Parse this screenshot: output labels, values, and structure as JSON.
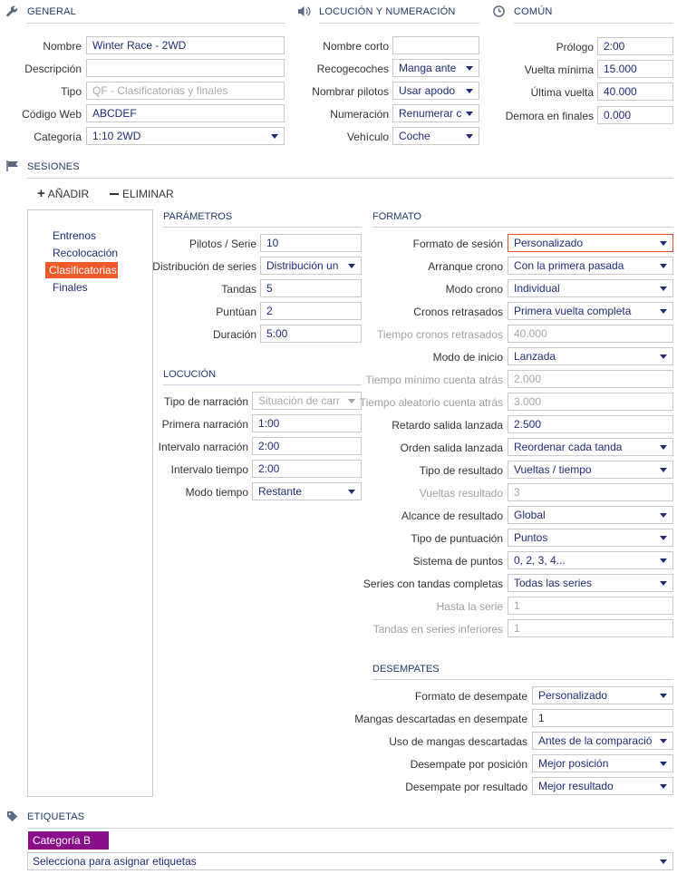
{
  "general": {
    "title": "GENERAL",
    "fields": [
      {
        "label": "Nombre",
        "value": "Winter Race - 2WD",
        "placeholder": ""
      },
      {
        "label": "Descripción",
        "value": "",
        "placeholder": ""
      },
      {
        "label": "Tipo",
        "value": "QF - Clasificatorias y finales",
        "placeholder": ""
      },
      {
        "label": "Código Web",
        "value": "ABCDEF",
        "placeholder": ""
      },
      {
        "label": "Categoría",
        "value": "1:10 2WD",
        "placeholder": ""
      }
    ]
  },
  "locucion_numeracion": {
    "title": "LOCUCIÓN Y NUMERACIÓN",
    "fields": [
      {
        "label": "Nombre corto",
        "value": ""
      },
      {
        "label": "Recogecoches",
        "value": "Manga ante"
      },
      {
        "label": "Nombrar pilotos",
        "value": "Usar apodo"
      },
      {
        "label": "Numeración",
        "value": "Renumerar c"
      },
      {
        "label": "Vehículo",
        "value": "Coche"
      }
    ]
  },
  "comun": {
    "title": "COMÚN",
    "fields": [
      {
        "label": "Prólogo",
        "value": "2:00"
      },
      {
        "label": "Vuelta mínima",
        "value": "15.000"
      },
      {
        "label": "Última vuelta",
        "value": "40.000"
      },
      {
        "label": "Demora en finales",
        "value": "0.000"
      }
    ]
  },
  "sesiones": {
    "title": "SESIONES",
    "add_label": "AÑADIR",
    "remove_label": "ELIMINAR",
    "items": [
      "Entrenos",
      "Recolocación",
      "Clasificatorias",
      "Finales"
    ],
    "active_index": 2
  },
  "parametros": {
    "title": "PARÁMETROS",
    "fields": [
      {
        "label": "Pilotos / Serie",
        "value": "10"
      },
      {
        "label": "Distribución de series",
        "value": "Distribución un"
      },
      {
        "label": "Tandas",
        "value": "5"
      },
      {
        "label": "Puntúan",
        "value": "2"
      },
      {
        "label": "Duración",
        "value": "5:00"
      }
    ]
  },
  "locucion": {
    "title": "LOCUCIÓN",
    "fields": [
      {
        "label": "Tipo de narración",
        "value": "Situación de carr"
      },
      {
        "label": "Primera narración",
        "value": "1:00"
      },
      {
        "label": "Intervalo narración",
        "value": "2:00"
      },
      {
        "label": "Intervalo tiempo",
        "value": "2:00"
      },
      {
        "label": "Modo tiempo",
        "value": "Restante"
      }
    ]
  },
  "formato": {
    "title": "FORMATO",
    "fields": [
      {
        "label": "Formato de sesión",
        "value": "Personalizado"
      },
      {
        "label": "Arranque crono",
        "value": "Con la primera pasada"
      },
      {
        "label": "Modo crono",
        "value": "Individual"
      },
      {
        "label": "Cronos retrasados",
        "value": "Primera vuelta completa"
      },
      {
        "label": "Tiempo cronos retrasados",
        "value": "40.000"
      },
      {
        "label": "Modo de inicio",
        "value": "Lanzada"
      },
      {
        "label": "Tiempo mínimo cuenta atrás",
        "value": "2.000"
      },
      {
        "label": "Tiempo aleatorio cuenta atrás",
        "value": "3.000"
      },
      {
        "label": "Retardo salida lanzada",
        "value": "2.500"
      },
      {
        "label": "Orden salida lanzada",
        "value": "Reordenar cada tanda"
      },
      {
        "label": "Tipo de resultado",
        "value": "Vueltas / tiempo"
      },
      {
        "label": "Vueltas resultado",
        "value": "3"
      },
      {
        "label": "Alcance de resultado",
        "value": "Global"
      },
      {
        "label": "Tipo de puntuación",
        "value": "Puntos"
      },
      {
        "label": "Sistema de puntos",
        "value": "0, 2, 3, 4..."
      },
      {
        "label": "Series con tandas completas",
        "value": "Todas las series"
      },
      {
        "label": "Hasta la serie",
        "value": "1"
      },
      {
        "label": "Tandas en series inferiores",
        "value": "1"
      }
    ]
  },
  "desempates": {
    "title": "DESEMPATES",
    "fields": [
      {
        "label": "Formato de desempate",
        "value": "Personalizado"
      },
      {
        "label": "Mangas descartadas en desempate",
        "value": "1"
      },
      {
        "label": "Uso de mangas descartadas",
        "value": "Antes de la comparació"
      },
      {
        "label": "Desempate por posición",
        "value": "Mejor posición"
      },
      {
        "label": "Desempate por resultado",
        "value": "Mejor resultado"
      }
    ]
  },
  "etiquetas": {
    "title": "ETIQUETAS",
    "tag": "Categoría B",
    "select_placeholder": "Selecciona para asignar etiquetas"
  },
  "colors": {
    "accent": "#f05a28",
    "value_text": "#1f2c77",
    "section_title": "#1f3a66",
    "tag": "#8a0d8a"
  }
}
